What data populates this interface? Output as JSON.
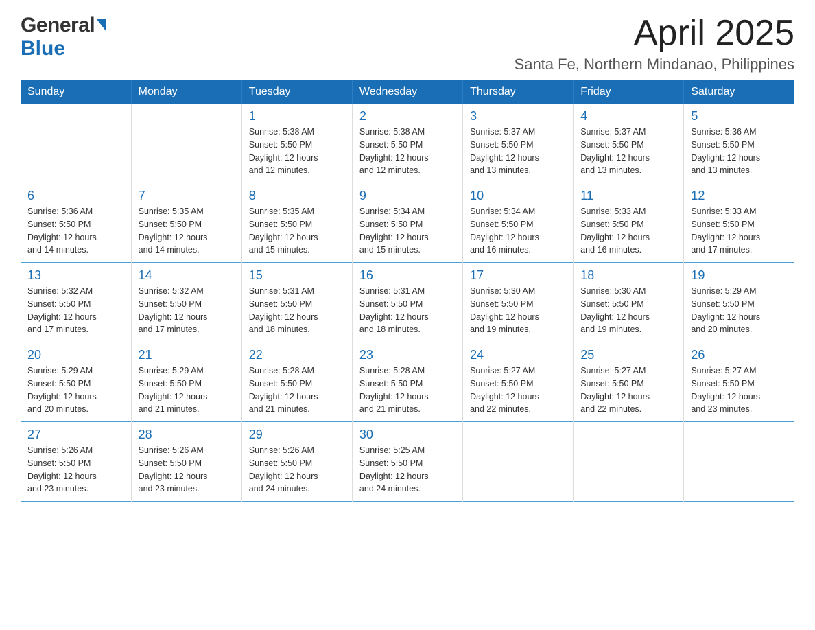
{
  "header": {
    "logo_general": "General",
    "logo_blue": "Blue",
    "month_title": "April 2025",
    "location": "Santa Fe, Northern Mindanao, Philippines"
  },
  "calendar": {
    "days_of_week": [
      "Sunday",
      "Monday",
      "Tuesday",
      "Wednesday",
      "Thursday",
      "Friday",
      "Saturday"
    ],
    "weeks": [
      [
        {
          "day": "",
          "info": ""
        },
        {
          "day": "",
          "info": ""
        },
        {
          "day": "1",
          "info": "Sunrise: 5:38 AM\nSunset: 5:50 PM\nDaylight: 12 hours\nand 12 minutes."
        },
        {
          "day": "2",
          "info": "Sunrise: 5:38 AM\nSunset: 5:50 PM\nDaylight: 12 hours\nand 12 minutes."
        },
        {
          "day": "3",
          "info": "Sunrise: 5:37 AM\nSunset: 5:50 PM\nDaylight: 12 hours\nand 13 minutes."
        },
        {
          "day": "4",
          "info": "Sunrise: 5:37 AM\nSunset: 5:50 PM\nDaylight: 12 hours\nand 13 minutes."
        },
        {
          "day": "5",
          "info": "Sunrise: 5:36 AM\nSunset: 5:50 PM\nDaylight: 12 hours\nand 13 minutes."
        }
      ],
      [
        {
          "day": "6",
          "info": "Sunrise: 5:36 AM\nSunset: 5:50 PM\nDaylight: 12 hours\nand 14 minutes."
        },
        {
          "day": "7",
          "info": "Sunrise: 5:35 AM\nSunset: 5:50 PM\nDaylight: 12 hours\nand 14 minutes."
        },
        {
          "day": "8",
          "info": "Sunrise: 5:35 AM\nSunset: 5:50 PM\nDaylight: 12 hours\nand 15 minutes."
        },
        {
          "day": "9",
          "info": "Sunrise: 5:34 AM\nSunset: 5:50 PM\nDaylight: 12 hours\nand 15 minutes."
        },
        {
          "day": "10",
          "info": "Sunrise: 5:34 AM\nSunset: 5:50 PM\nDaylight: 12 hours\nand 16 minutes."
        },
        {
          "day": "11",
          "info": "Sunrise: 5:33 AM\nSunset: 5:50 PM\nDaylight: 12 hours\nand 16 minutes."
        },
        {
          "day": "12",
          "info": "Sunrise: 5:33 AM\nSunset: 5:50 PM\nDaylight: 12 hours\nand 17 minutes."
        }
      ],
      [
        {
          "day": "13",
          "info": "Sunrise: 5:32 AM\nSunset: 5:50 PM\nDaylight: 12 hours\nand 17 minutes."
        },
        {
          "day": "14",
          "info": "Sunrise: 5:32 AM\nSunset: 5:50 PM\nDaylight: 12 hours\nand 17 minutes."
        },
        {
          "day": "15",
          "info": "Sunrise: 5:31 AM\nSunset: 5:50 PM\nDaylight: 12 hours\nand 18 minutes."
        },
        {
          "day": "16",
          "info": "Sunrise: 5:31 AM\nSunset: 5:50 PM\nDaylight: 12 hours\nand 18 minutes."
        },
        {
          "day": "17",
          "info": "Sunrise: 5:30 AM\nSunset: 5:50 PM\nDaylight: 12 hours\nand 19 minutes."
        },
        {
          "day": "18",
          "info": "Sunrise: 5:30 AM\nSunset: 5:50 PM\nDaylight: 12 hours\nand 19 minutes."
        },
        {
          "day": "19",
          "info": "Sunrise: 5:29 AM\nSunset: 5:50 PM\nDaylight: 12 hours\nand 20 minutes."
        }
      ],
      [
        {
          "day": "20",
          "info": "Sunrise: 5:29 AM\nSunset: 5:50 PM\nDaylight: 12 hours\nand 20 minutes."
        },
        {
          "day": "21",
          "info": "Sunrise: 5:29 AM\nSunset: 5:50 PM\nDaylight: 12 hours\nand 21 minutes."
        },
        {
          "day": "22",
          "info": "Sunrise: 5:28 AM\nSunset: 5:50 PM\nDaylight: 12 hours\nand 21 minutes."
        },
        {
          "day": "23",
          "info": "Sunrise: 5:28 AM\nSunset: 5:50 PM\nDaylight: 12 hours\nand 21 minutes."
        },
        {
          "day": "24",
          "info": "Sunrise: 5:27 AM\nSunset: 5:50 PM\nDaylight: 12 hours\nand 22 minutes."
        },
        {
          "day": "25",
          "info": "Sunrise: 5:27 AM\nSunset: 5:50 PM\nDaylight: 12 hours\nand 22 minutes."
        },
        {
          "day": "26",
          "info": "Sunrise: 5:27 AM\nSunset: 5:50 PM\nDaylight: 12 hours\nand 23 minutes."
        }
      ],
      [
        {
          "day": "27",
          "info": "Sunrise: 5:26 AM\nSunset: 5:50 PM\nDaylight: 12 hours\nand 23 minutes."
        },
        {
          "day": "28",
          "info": "Sunrise: 5:26 AM\nSunset: 5:50 PM\nDaylight: 12 hours\nand 23 minutes."
        },
        {
          "day": "29",
          "info": "Sunrise: 5:26 AM\nSunset: 5:50 PM\nDaylight: 12 hours\nand 24 minutes."
        },
        {
          "day": "30",
          "info": "Sunrise: 5:25 AM\nSunset: 5:50 PM\nDaylight: 12 hours\nand 24 minutes."
        },
        {
          "day": "",
          "info": ""
        },
        {
          "day": "",
          "info": ""
        },
        {
          "day": "",
          "info": ""
        }
      ]
    ]
  }
}
